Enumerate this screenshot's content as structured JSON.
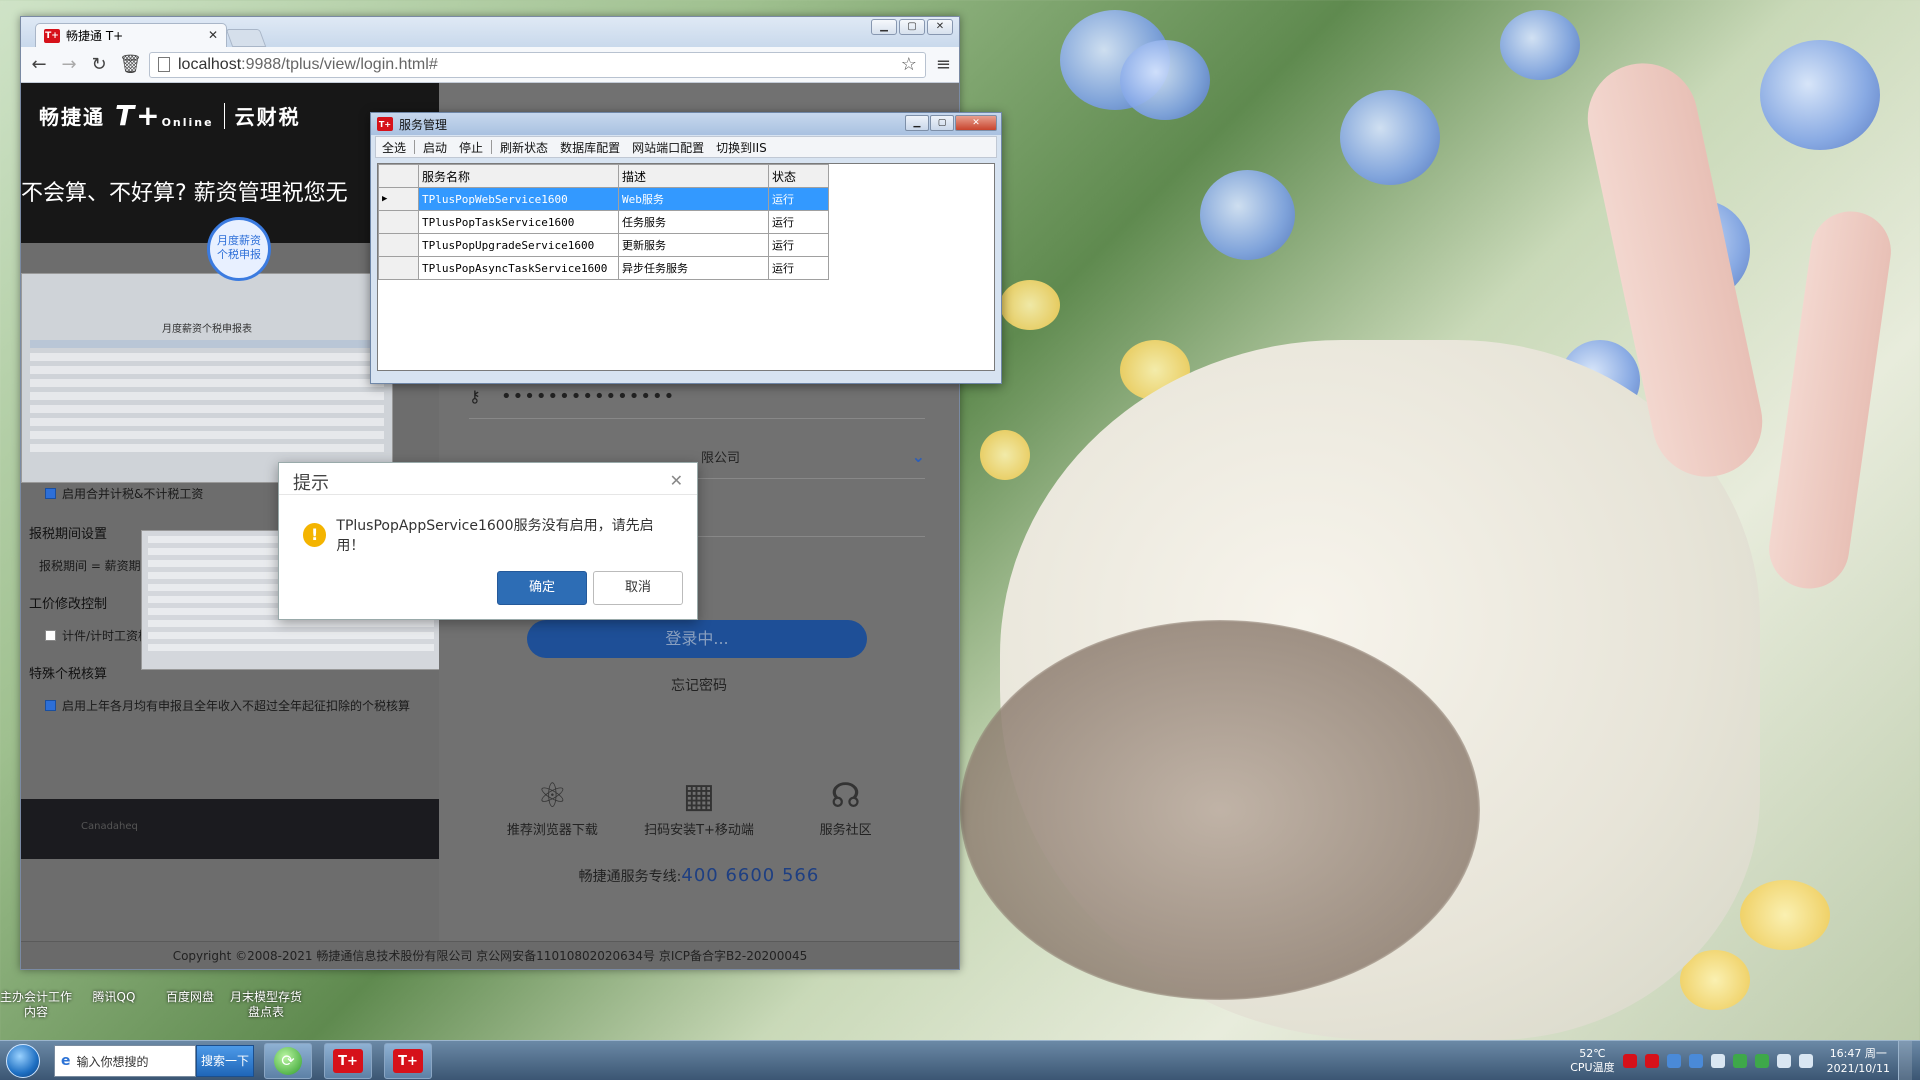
{
  "desktop": {
    "icons": [
      "主办会计工作\n内容",
      "腾讯QQ",
      "百度网盘",
      "月末模型存货\n盘点表"
    ]
  },
  "browser": {
    "tab_title": "畅捷通 T+",
    "url_host": "localhost",
    "url_rest": ":9988/tplus/view/login.html#"
  },
  "promo": {
    "brand": "畅捷通",
    "tplus": "T+",
    "tplus_sub": "Online",
    "cloud_tax": "云财税",
    "headline": "不会算、不好算?   薪资管理祝您无",
    "badge": "月度薪资\n个税申报",
    "report_title": "月度薪资个税申报表",
    "checks": {
      "item1": "启用合并计税&不计税工资",
      "section1": "报税期间设置",
      "period": "报税期间 = 薪资期间",
      "section2": "工价修改控制",
      "item2": "计件/计时工资核",
      "section3": "特殊个税核算",
      "item3": "启用上年各月均有申报且全年收入不超过全年起征扣除的个税核算"
    },
    "footer_sign": "Canadaheq"
  },
  "login": {
    "password_mask": "•••••••••••••••",
    "company_suffix": "限公司",
    "login_button": "登录中...",
    "forgot": "忘记密码",
    "features": [
      "推荐浏览器下载",
      "扫码安装T+移动端",
      "服务社区"
    ],
    "hotline_label": "畅捷通服务专线:",
    "hotline_number": "400  6600  566",
    "copyright": "Copyright ©2008-2021 畅捷通信息技术股份有限公司 京公网安备11010802020634号 京ICP备合字B2-20200045"
  },
  "service_manager": {
    "title": "服务管理",
    "menu": [
      "全选",
      "启动",
      "停止",
      "刷新状态",
      "数据库配置",
      "网站端口配置",
      "切换到IIS"
    ],
    "columns": [
      "服务名称",
      "描述",
      "状态"
    ],
    "rows": [
      {
        "name": "TPlusPopWebService1600",
        "desc": "Web服务",
        "status": "运行"
      },
      {
        "name": "TPlusPopTaskService1600",
        "desc": "任务服务",
        "status": "运行"
      },
      {
        "name": "TPlusPopUpgradeService1600",
        "desc": "更新服务",
        "status": "运行"
      },
      {
        "name": "TPlusPopAsyncTaskService1600",
        "desc": "异步任务服务",
        "status": "运行"
      }
    ]
  },
  "dialog": {
    "title": "提示",
    "message": "TPlusPopAppService1600服务没有启用，请先启用！",
    "ok": "确定",
    "cancel": "取消"
  },
  "taskbar": {
    "search_placeholder": "输入你想搜的",
    "search_button": "搜索一下",
    "temp": "52℃",
    "temp_label": "CPU温度",
    "time": "16:47 周一",
    "date": "2021/10/11"
  }
}
